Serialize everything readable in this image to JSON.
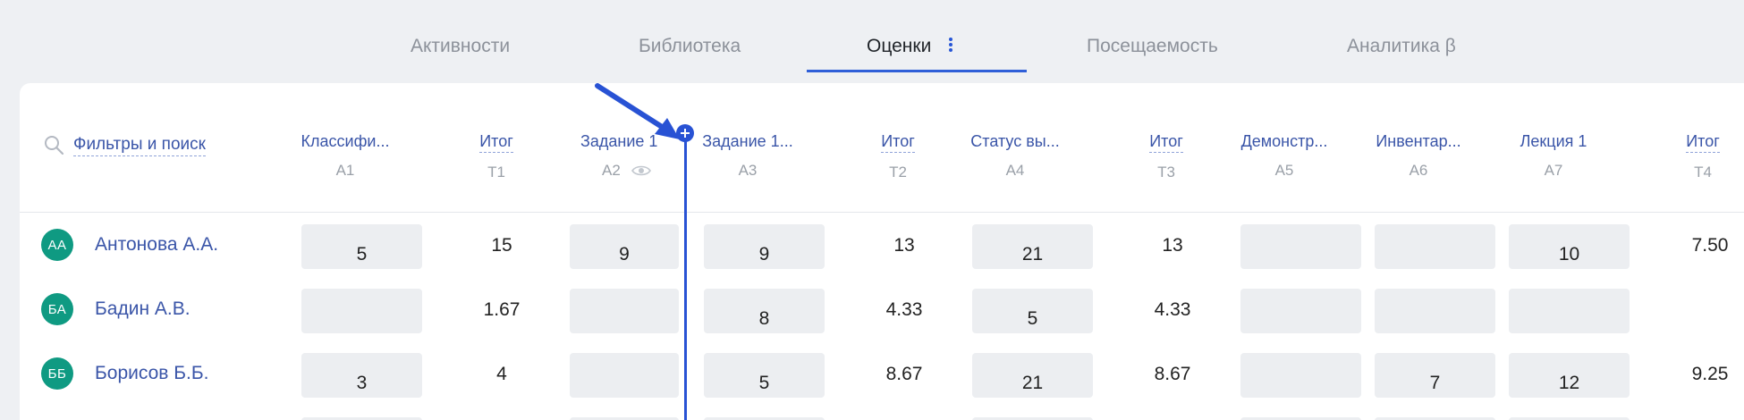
{
  "tabs": {
    "activities": "Активности",
    "library": "Библиотека",
    "grades": "Оценки",
    "attendance": "Посещаемость",
    "analytics": "Аналитика β"
  },
  "filter": {
    "label": "Фильтры и поиск"
  },
  "columns": [
    {
      "title": "Классифи...",
      "code": "A1"
    },
    {
      "title": "Итог",
      "code": "T1"
    },
    {
      "title": "Задание 1",
      "code": "A2"
    },
    {
      "title": "Задание 1...",
      "code": "A3"
    },
    {
      "title": "Итог",
      "code": "T2"
    },
    {
      "title": "Статус вы...",
      "code": "A4"
    },
    {
      "title": "Итог",
      "code": "T3"
    },
    {
      "title": "Демонстр...",
      "code": "A5"
    },
    {
      "title": "Инвентар...",
      "code": "A6"
    },
    {
      "title": "Лекция 1",
      "code": "A7"
    },
    {
      "title": "Итог",
      "code": "T4"
    }
  ],
  "students": [
    {
      "initials": "АА",
      "name": "Антонова А.А.",
      "values": [
        "5",
        "15",
        "9",
        "9",
        "13",
        "21",
        "13",
        "",
        "",
        "10",
        "7.50"
      ]
    },
    {
      "initials": "БА",
      "name": "Бадин А.В.",
      "values": [
        "",
        "1.67",
        "",
        "8",
        "4.33",
        "5",
        "4.33",
        "",
        "",
        "",
        ""
      ]
    },
    {
      "initials": "ББ",
      "name": "Борисов Б.Б.",
      "values": [
        "3",
        "4",
        "",
        "5",
        "8.67",
        "21",
        "8.67",
        "",
        "7",
        "12",
        "9.25"
      ]
    }
  ],
  "icons": {
    "search": "search-icon",
    "more": "more-vertical-icon",
    "hidden": "eye-icon",
    "add": "plus-circle-icon",
    "pointer": "arrow-icon"
  },
  "colors": {
    "accent": "#2f5fd8",
    "link": "#3a55a8",
    "avatar": "#0f9a82"
  }
}
